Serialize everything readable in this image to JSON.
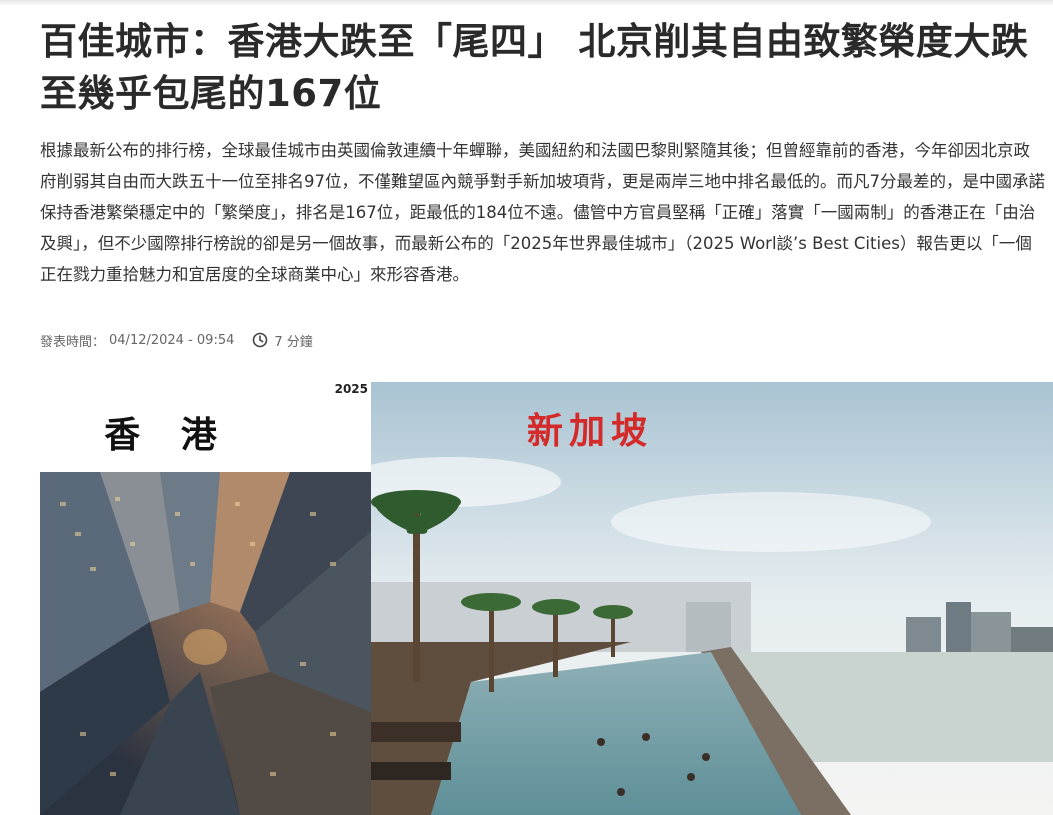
{
  "article": {
    "headline": "百佳城市：香港大跌至「尾四」 北京削其自由致繁榮度大跌至幾乎包尾的167位",
    "lede": "根據最新公布的排行榜，全球最佳城市由英國倫敦連續十年蟬聯，美國紐約和法國巴黎則緊隨其後；但曾經靠前的香港，今年卻因北京政府削弱其自由而大跌五十一位至排名97位，不僅難望區內競爭對手新加坡項背，更是兩岸三地中排名最低的。而凡7分最差的，是中國承諾保持香港繁榮穩定中的「繁榮度」，排名是167位，距最低的184位不遠。儘管中方官員堅稱「正確」落實「一國兩制」的香港正在「由治及興」，但不少國際排行榜說的卻是另一個故事，而最新公布的「2025年世界最佳城市」（2025 Worl談’s Best Cities）報告更以「一個正在戮力重拾魅力和宜居度的全球商業中心」來形容香港。",
    "published_label": "發表時間：",
    "published_value": "04/12/2024 - 09:54",
    "read_time": "7 分鐘"
  },
  "image": {
    "year": "2025",
    "left_label": "香 港",
    "right_label": "新加坡"
  },
  "icons": {
    "clock": "clock-icon"
  },
  "colors": {
    "singapore_label": "#d42a2a",
    "headline": "#2a2a2a"
  }
}
